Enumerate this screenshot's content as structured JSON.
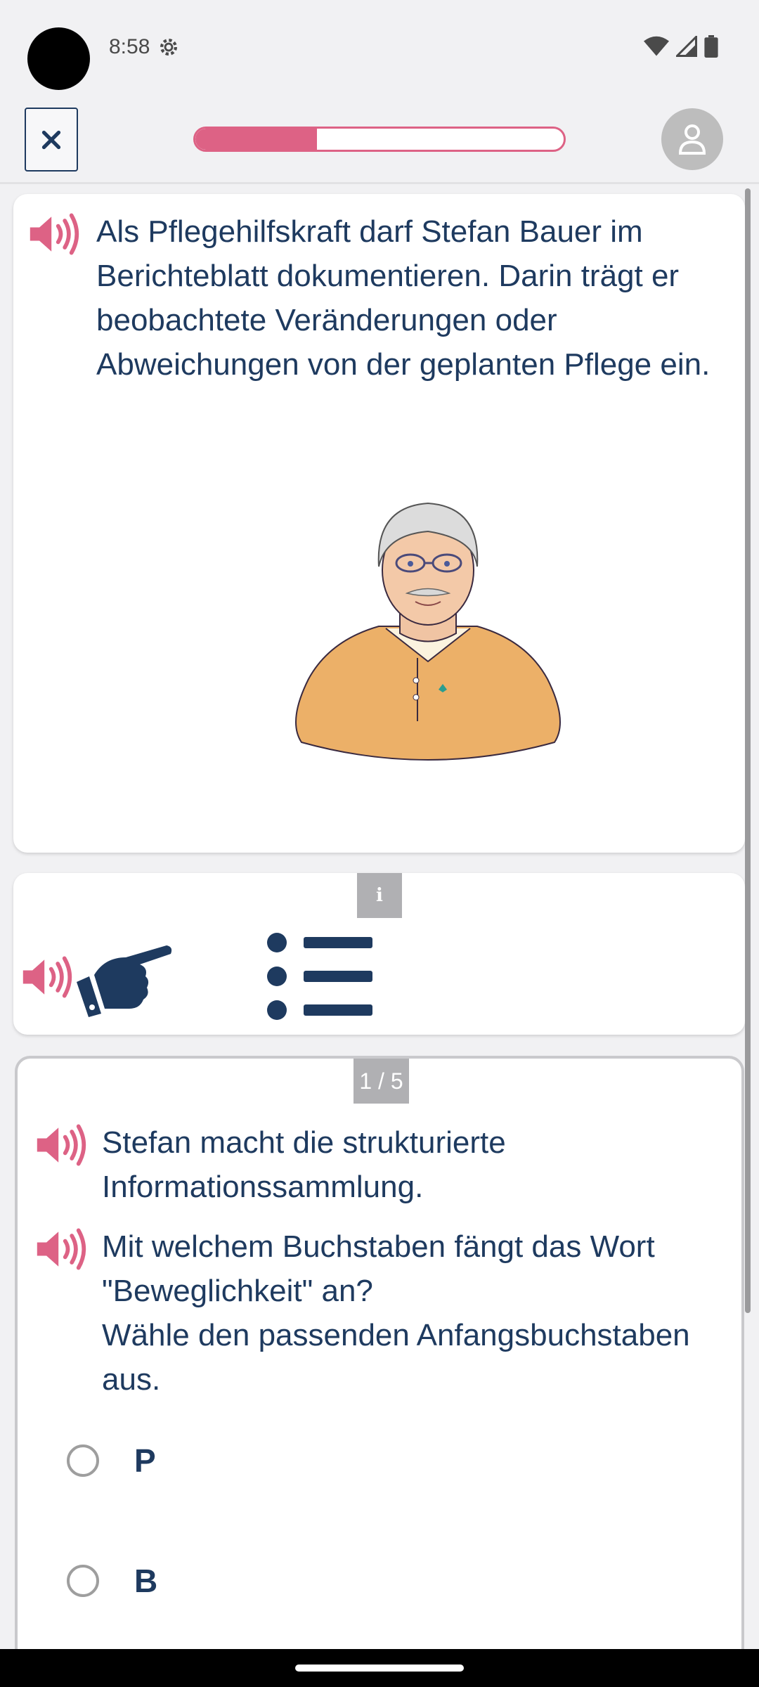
{
  "status_bar": {
    "time": "8:58"
  },
  "progress": {
    "fraction": 0.33,
    "accent": "#dd6285"
  },
  "intro": {
    "text": "Als Pflegehilfskraft darf Stefan Bauer im Berichteblatt dokumentieren. Darin trägt er beobachtete Veränderungen oder Abweichungen von der geplanten Pflege ein."
  },
  "tools": {
    "info_label": "i"
  },
  "question": {
    "counter": "1 / 5",
    "context": "Stefan macht die strukturierte Informationssammlung.",
    "prompt": "Mit welchem Buchstaben fängt das Wort \"Beweglichkeit\" an?\nWähle den passenden Anfangsbuchstaben aus.",
    "options": [
      "P",
      "B"
    ]
  },
  "colors": {
    "text": "#1e3a5f",
    "accent": "#dd6285"
  }
}
